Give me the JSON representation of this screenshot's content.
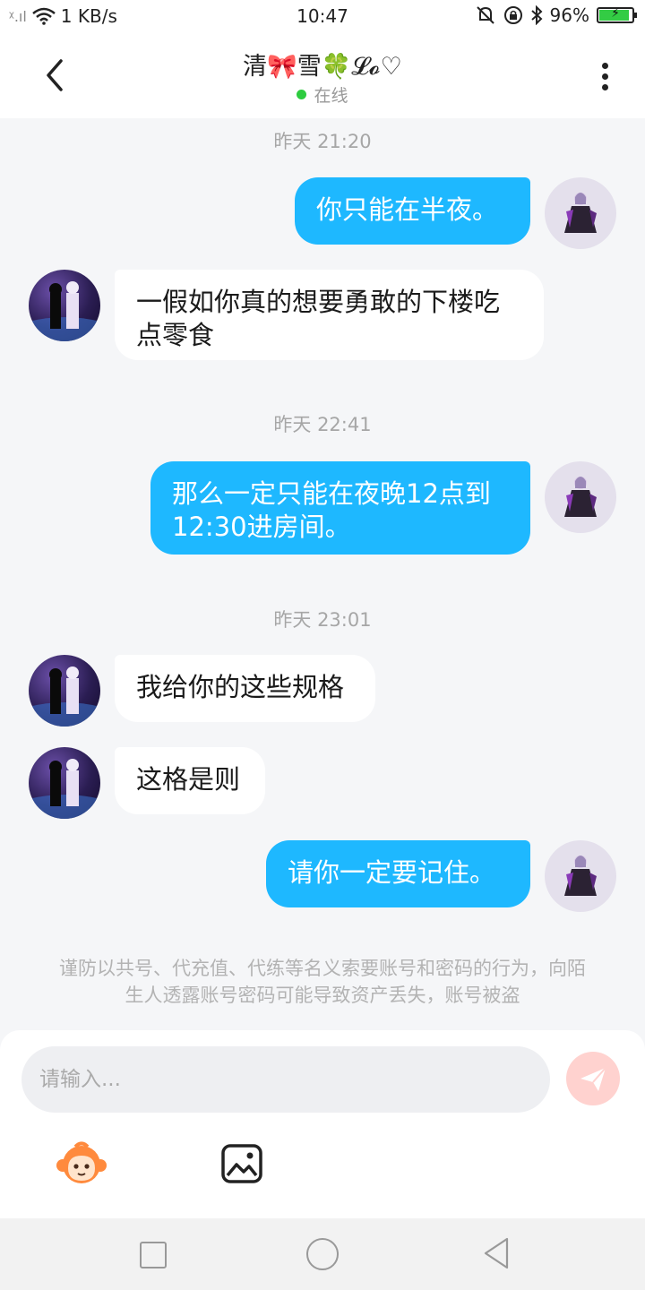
{
  "status_bar": {
    "signal": "ᵡ.ıl",
    "network_speed": "1 KB/s",
    "time": "10:47",
    "battery_percent": "96%",
    "battery_level": 0.96
  },
  "header": {
    "title": "清🎀雪🍀𝓛𝓸♡",
    "presence": "在线"
  },
  "messages": [
    {
      "timestamp": "昨天 21:20"
    },
    {
      "from": "me",
      "text": "你只能在半夜。"
    },
    {
      "from": "other",
      "text": "一假如你真的想要勇敢的下楼吃点零食"
    },
    {
      "timestamp": "昨天 22:41"
    },
    {
      "from": "me",
      "text": "那么一定只能在夜晚12点到12:30进房间。"
    },
    {
      "timestamp": "昨天 23:01"
    },
    {
      "from": "other",
      "text": "我给你的这些规格"
    },
    {
      "from": "other",
      "text": "这格是则"
    },
    {
      "from": "me",
      "text": "请你一定要记住。"
    }
  ],
  "notice": "谨防以共号、代充值、代练等名义索要账号和密码的行为，向陌生人透露账号密码可能导致资产丢失，账号被盗",
  "composer": {
    "placeholder": "请输入...",
    "value": ""
  },
  "icons": {
    "emoji": "monkey-emoji-icon",
    "image": "image-icon",
    "send": "paper-plane-icon"
  },
  "colors": {
    "outgoing_bubble": "#1eb8ff",
    "incoming_bubble": "#ffffff",
    "online_dot": "#2ecc40",
    "send_disabled": "#ffd2cf"
  }
}
